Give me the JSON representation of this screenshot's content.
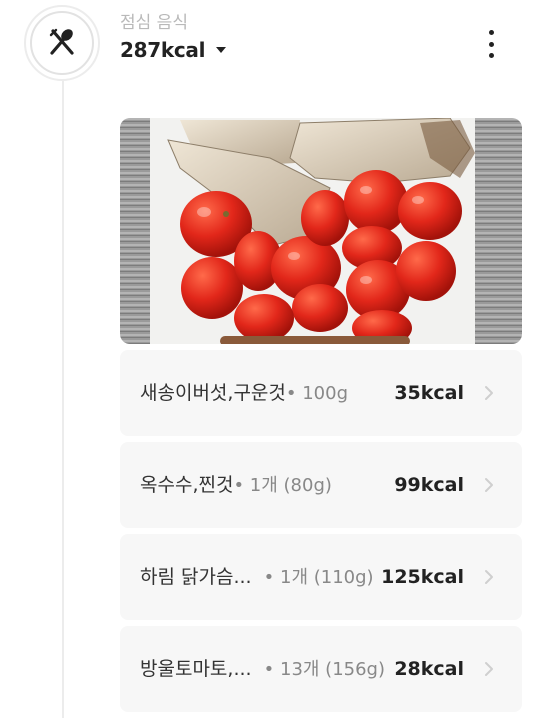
{
  "meal": {
    "title": "점심 음식",
    "total_kcal": "287kcal",
    "icon": "fork-spoon-icon",
    "menu_icon": "more-vertical-icon"
  },
  "photo": {
    "description_icon": "meal-photo"
  },
  "food_items": [
    {
      "name": "새송이버섯,구운것",
      "amount": "• 100g",
      "kcal": "35kcal"
    },
    {
      "name": "옥수수,찐것",
      "amount": "• 1개 (80g)",
      "kcal": "99kcal"
    },
    {
      "name": "하림 닭가슴...",
      "amount": "• 1개 (110g)",
      "kcal": "125kcal"
    },
    {
      "name": "방울토마토,...",
      "amount": "• 13개 (156g)",
      "kcal": "28kcal"
    }
  ],
  "colors": {
    "tomato": "#e2271a",
    "item_bg": "#f7f7f7",
    "title_gray": "#b9b9b9"
  }
}
